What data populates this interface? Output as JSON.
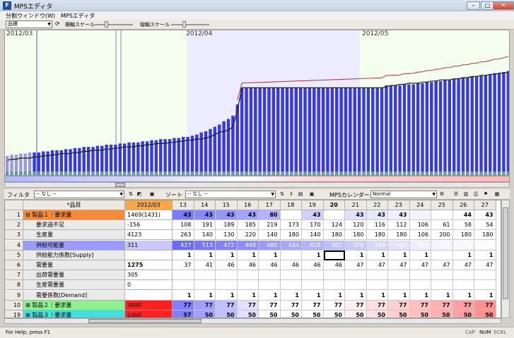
{
  "window": {
    "title": "MPSエディタ",
    "app_icon": "F"
  },
  "menubar": {
    "items": [
      "分割ウィンドウ(W)",
      "MPSエディタ"
    ]
  },
  "toolbar_top": {
    "mode_select": "品積",
    "label_vertical_scale": "横軸スケール",
    "label_horizontal_scale": "縦軸スケール"
  },
  "chart": {
    "date_labels": [
      "2012/03",
      "2012/04",
      "2012/05"
    ]
  },
  "chart_data": {
    "type": "bar",
    "bar_values": [
      14,
      15,
      15,
      16,
      16,
      17,
      17,
      17,
      18,
      18,
      19,
      19,
      19,
      20,
      20,
      21,
      21,
      22,
      22,
      22,
      23,
      23,
      24,
      24,
      24,
      25,
      25,
      26,
      26,
      26,
      27,
      27,
      28,
      28,
      29,
      29,
      29,
      30,
      30,
      31,
      31,
      32,
      33,
      35,
      36,
      38,
      40,
      42,
      45,
      47,
      50,
      60,
      75,
      75,
      75,
      75,
      75,
      75,
      75,
      75,
      75,
      75,
      75,
      75,
      75,
      75,
      75,
      75,
      75,
      75,
      75,
      75,
      75,
      75,
      75,
      75,
      75,
      75,
      75,
      75,
      75,
      75,
      75,
      75,
      77,
      77,
      77,
      77,
      78,
      78,
      78,
      79,
      79,
      80,
      80,
      81,
      81,
      82,
      82,
      83,
      83,
      84,
      84,
      85,
      85,
      86,
      86,
      87,
      88,
      88,
      89,
      90
    ],
    "line_values": [
      10,
      11,
      11,
      12,
      12,
      12,
      13,
      13,
      14,
      14,
      15,
      15,
      16,
      16,
      16,
      17,
      17,
      18,
      18,
      19,
      19,
      19,
      20,
      20,
      21,
      21,
      22,
      22,
      22,
      23,
      23,
      24,
      24,
      25,
      25,
      25,
      26,
      26,
      27,
      27,
      28,
      28,
      29,
      29,
      30,
      31,
      33,
      35,
      36,
      37,
      40,
      55,
      75,
      75,
      75,
      75,
      75,
      75,
      75,
      75,
      75,
      75,
      75,
      75,
      75,
      75,
      75,
      75,
      75,
      75,
      75,
      75,
      75,
      75,
      75,
      75,
      75,
      75,
      75,
      75,
      75,
      75,
      75,
      75,
      76,
      77,
      77,
      78,
      78,
      79,
      79,
      79,
      80,
      80,
      81,
      81,
      82,
      82,
      82,
      83,
      83,
      84,
      84,
      85,
      85,
      86,
      86,
      87,
      87,
      88,
      88,
      89
    ],
    "ylim": [
      0,
      120
    ]
  },
  "toolbar_filter": {
    "filter_label": "フィルタ",
    "filter_value": "-- なし --",
    "sort_label": "ソート",
    "sort_value": "-- なし --",
    "calendar_label": "MPSカレンダー",
    "calendar_value": "Normal"
  },
  "grid": {
    "item_header": "*品目",
    "date_header": "2012/03",
    "day_headers": [
      "13",
      "14",
      "15",
      "16",
      "17",
      "18",
      "19",
      "20",
      "21",
      "22",
      "23",
      "24",
      "25",
      "26",
      "27"
    ],
    "rows": [
      {
        "no": "1",
        "name": "⊟ 製品１｜要求量",
        "total": "1469(1431)",
        "values": [
          "43",
          "43",
          "43",
          "43",
          "80",
          "",
          "43",
          "",
          "43",
          "43",
          "43",
          "",
          "",
          "44",
          "43"
        ],
        "style": "orange"
      },
      {
        "no": "2",
        "name": "要求過不足",
        "total": "-156",
        "values": [
          "108",
          "191",
          "189",
          "185",
          "219",
          "173",
          "170",
          "124",
          "120",
          "116",
          "112",
          "106",
          "61",
          "58",
          "54"
        ],
        "style": "plain"
      },
      {
        "no": "3",
        "name": "生産量",
        "total": "4123",
        "values": [
          "263",
          "140",
          "130",
          "220",
          "140",
          "180",
          "140",
          "180",
          "180",
          "180",
          "180",
          "106",
          "200",
          "180",
          "180"
        ],
        "style": "plain"
      },
      {
        "no": "4",
        "name": "供給可能量",
        "total": "311",
        "values": [
          "427",
          "513",
          "472",
          "449",
          "480",
          "434",
          "428",
          "382",
          "376",
          "369",
          "362",
          "355",
          "308",
          "321",
          "314"
        ],
        "style": "blue"
      },
      {
        "no": "5",
        "name": "供給能力係数[Supply]",
        "total": "",
        "values": [
          "1",
          "1",
          "1",
          "1",
          "1",
          "",
          "1",
          "",
          "1",
          "1",
          "1",
          "1",
          "",
          "1",
          "1"
        ],
        "style": "plain"
      },
      {
        "no": "6",
        "name": "需要量",
        "total": "1275",
        "values": [
          "37",
          "41",
          "46",
          "46",
          "46",
          "46",
          "46",
          "46",
          "47",
          "47",
          "47",
          "47",
          "47",
          "47",
          "47"
        ],
        "style": "plain"
      },
      {
        "no": "7",
        "name": "出荷需要量",
        "total": "305",
        "values": [
          "",
          "",
          "",
          "",
          "",
          "",
          "",
          "",
          "",
          "",
          "",
          "",
          "",
          "",
          ""
        ],
        "style": "plain"
      },
      {
        "no": "8",
        "name": "生産需要量",
        "total": "0",
        "values": [
          "",
          "",
          "",
          "",
          "",
          "",
          "",
          "",
          "",
          "",
          "",
          "",
          "",
          "",
          ""
        ],
        "style": "plain"
      },
      {
        "no": "9",
        "name": "需要係数[Demand]",
        "total": "",
        "values": [
          "1",
          "1",
          "1",
          "1",
          "1",
          "1",
          "1",
          "1",
          "1",
          "1",
          "1",
          "1",
          "1",
          "1",
          "1"
        ],
        "style": "plain"
      },
      {
        "no": "10",
        "name": "⊞ 製品２｜要求量",
        "total": "3080",
        "values": [
          "77",
          "77",
          "77",
          "77",
          "77",
          "77",
          "77",
          "77",
          "77",
          "77",
          "77",
          "77",
          "77",
          "77",
          "77"
        ],
        "style": "green"
      },
      {
        "no": "19",
        "name": "⊞ 製品３｜要求量",
        "total": "1560",
        "values": [
          "57",
          "50",
          "50",
          "50",
          "50",
          "50",
          "50",
          "50",
          "50",
          "50",
          "50",
          "50",
          "50",
          "50",
          "50"
        ],
        "style": "cyan"
      }
    ]
  },
  "statusbar": {
    "help": "For Help, press F1",
    "indicators": [
      "CAP",
      "NUM",
      "SCRL"
    ]
  }
}
